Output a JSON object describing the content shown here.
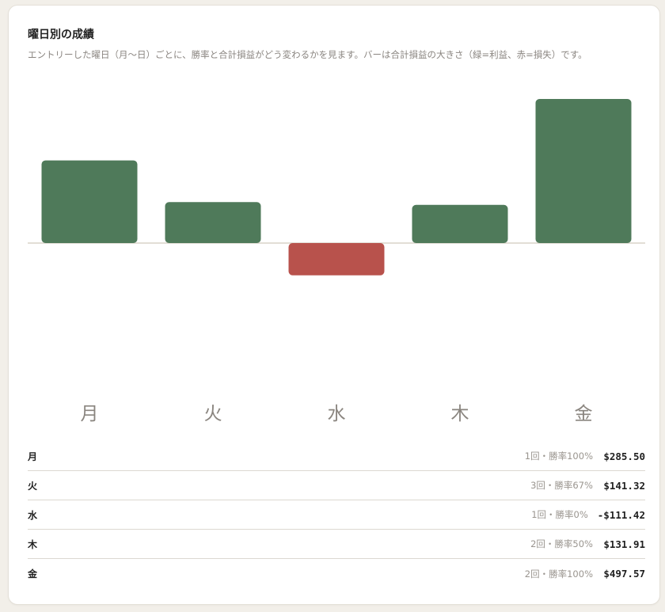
{
  "header": {
    "title": "曜日別の成績",
    "subtitle": "エントリーした曜日（月〜日）ごとに、勝率と合計損益がどう変わるかを見ます。バーは合計損益の大きさ（緑=利益、赤=損失）です。"
  },
  "colors": {
    "profit": "#4f7a5a",
    "loss": "#b8524c",
    "baseline": "#d9d3c8",
    "day_label": "#8a857f"
  },
  "chart_data": {
    "type": "bar",
    "categories": [
      "月",
      "火",
      "水",
      "木",
      "金"
    ],
    "values": [
      285.5,
      141.32,
      -111.42,
      131.91,
      497.57
    ],
    "title": "曜日別の成績",
    "xlabel": "",
    "ylabel": "",
    "ylim": [
      -497.57,
      497.57
    ],
    "grid": false,
    "legend": "none"
  },
  "rows": [
    {
      "day": "月",
      "meta": "1回・勝率100%",
      "pnl": "$285.50"
    },
    {
      "day": "火",
      "meta": "3回・勝率67%",
      "pnl": "$141.32"
    },
    {
      "day": "水",
      "meta": "1回・勝率0%",
      "pnl": "-$111.42"
    },
    {
      "day": "木",
      "meta": "2回・勝率50%",
      "pnl": "$131.91"
    },
    {
      "day": "金",
      "meta": "2回・勝率100%",
      "pnl": "$497.57"
    }
  ]
}
